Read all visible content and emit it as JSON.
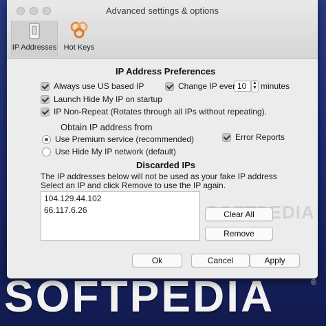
{
  "window": {
    "title": "Advanced settings & options"
  },
  "toolbar": {
    "ip_addresses": "IP Addresses",
    "hot_keys": "Hot Keys"
  },
  "preferences": {
    "heading": "IP Address Preferences",
    "always_us": {
      "label": "Always use US based IP",
      "checked": true
    },
    "change_ip": {
      "label": "Change IP every",
      "checked": true,
      "value": "10",
      "suffix": "minutes"
    },
    "launch_startup": {
      "label": "Launch Hide My IP on startup",
      "checked": true
    },
    "non_repeat": {
      "label": "IP Non-Repeat (Rotates through all IPs without repeating).",
      "checked": true
    }
  },
  "obtain": {
    "heading": "Obtain IP address from",
    "premium": {
      "label": "Use Premium service (recommended)",
      "selected": true
    },
    "network": {
      "label": "Use Hide My IP network (default)",
      "selected": false
    },
    "error_reports": {
      "label": "Error Reports",
      "checked": true
    }
  },
  "discarded": {
    "heading": "Discarded IPs",
    "desc_line1": "The IP addresses below will not be used as your fake IP address",
    "desc_line2": "Select an IP and click Remove to use the IP again.",
    "ips": [
      "104.129.44.102",
      "66.117.6.26"
    ],
    "clear_all": "Clear All",
    "remove": "Remove"
  },
  "footer": {
    "ok": "Ok",
    "cancel": "Cancel",
    "apply": "Apply"
  },
  "background": {
    "wordmark": "SOFTPEDIA",
    "trademark": "®",
    "watermark": "SOFTPEDIA"
  },
  "colors": {
    "window_bg": "#ececec",
    "background": "#1f2a66",
    "hotkey_icon": "#e8913a"
  }
}
